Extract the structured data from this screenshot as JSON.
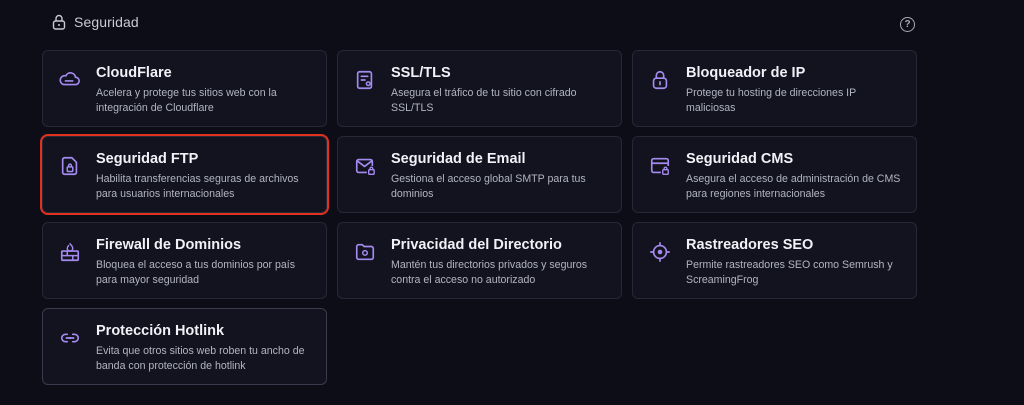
{
  "section": {
    "title": "Seguridad",
    "icon": "lock-icon",
    "help_icon": "help-icon",
    "help_glyph": "?"
  },
  "colors": {
    "accent": "#a58bf0",
    "highlight": "#e0321f",
    "background": "#0c0d17",
    "card": "#12131f"
  },
  "cards": [
    {
      "title": "CloudFlare",
      "description": "Acelera y protege tus sitios web con la integración de Cloudflare",
      "icon": "cloud-icon"
    },
    {
      "title": "SSL/TLS",
      "description": "Asegura el tráfico de tu sitio con cifrado SSL/TLS",
      "icon": "certificate-icon"
    },
    {
      "title": "Bloqueador de IP",
      "description": "Protege tu hosting de direcciones IP maliciosas",
      "icon": "padlock-icon"
    },
    {
      "title": "Seguridad FTP",
      "description": "Habilita transferencias seguras de archivos para usuarios internacionales",
      "icon": "secure-file-icon"
    },
    {
      "title": "Seguridad de Email",
      "description": "Gestiona el acceso global SMTP para tus dominios",
      "icon": "mail-lock-icon"
    },
    {
      "title": "Seguridad CMS",
      "description": "Asegura el acceso de administración de CMS para regiones internacionales",
      "icon": "browser-lock-icon"
    },
    {
      "title": "Firewall de Dominios",
      "description": "Bloquea el acceso a tus dominios por país para mayor seguridad",
      "icon": "firewall-icon"
    },
    {
      "title": "Privacidad del Directorio",
      "description": "Mantén tus directorios privados y seguros contra el acceso no autorizado",
      "icon": "folder-lock-icon"
    },
    {
      "title": "Rastreadores SEO",
      "description": "Permite rastreadores SEO como Semrush y ScreamingFrog",
      "icon": "crosshair-icon"
    },
    {
      "title": "Protección Hotlink",
      "description": "Evita que otros sitios web roben tu ancho de banda con protección de hotlink",
      "icon": "link-icon"
    }
  ]
}
